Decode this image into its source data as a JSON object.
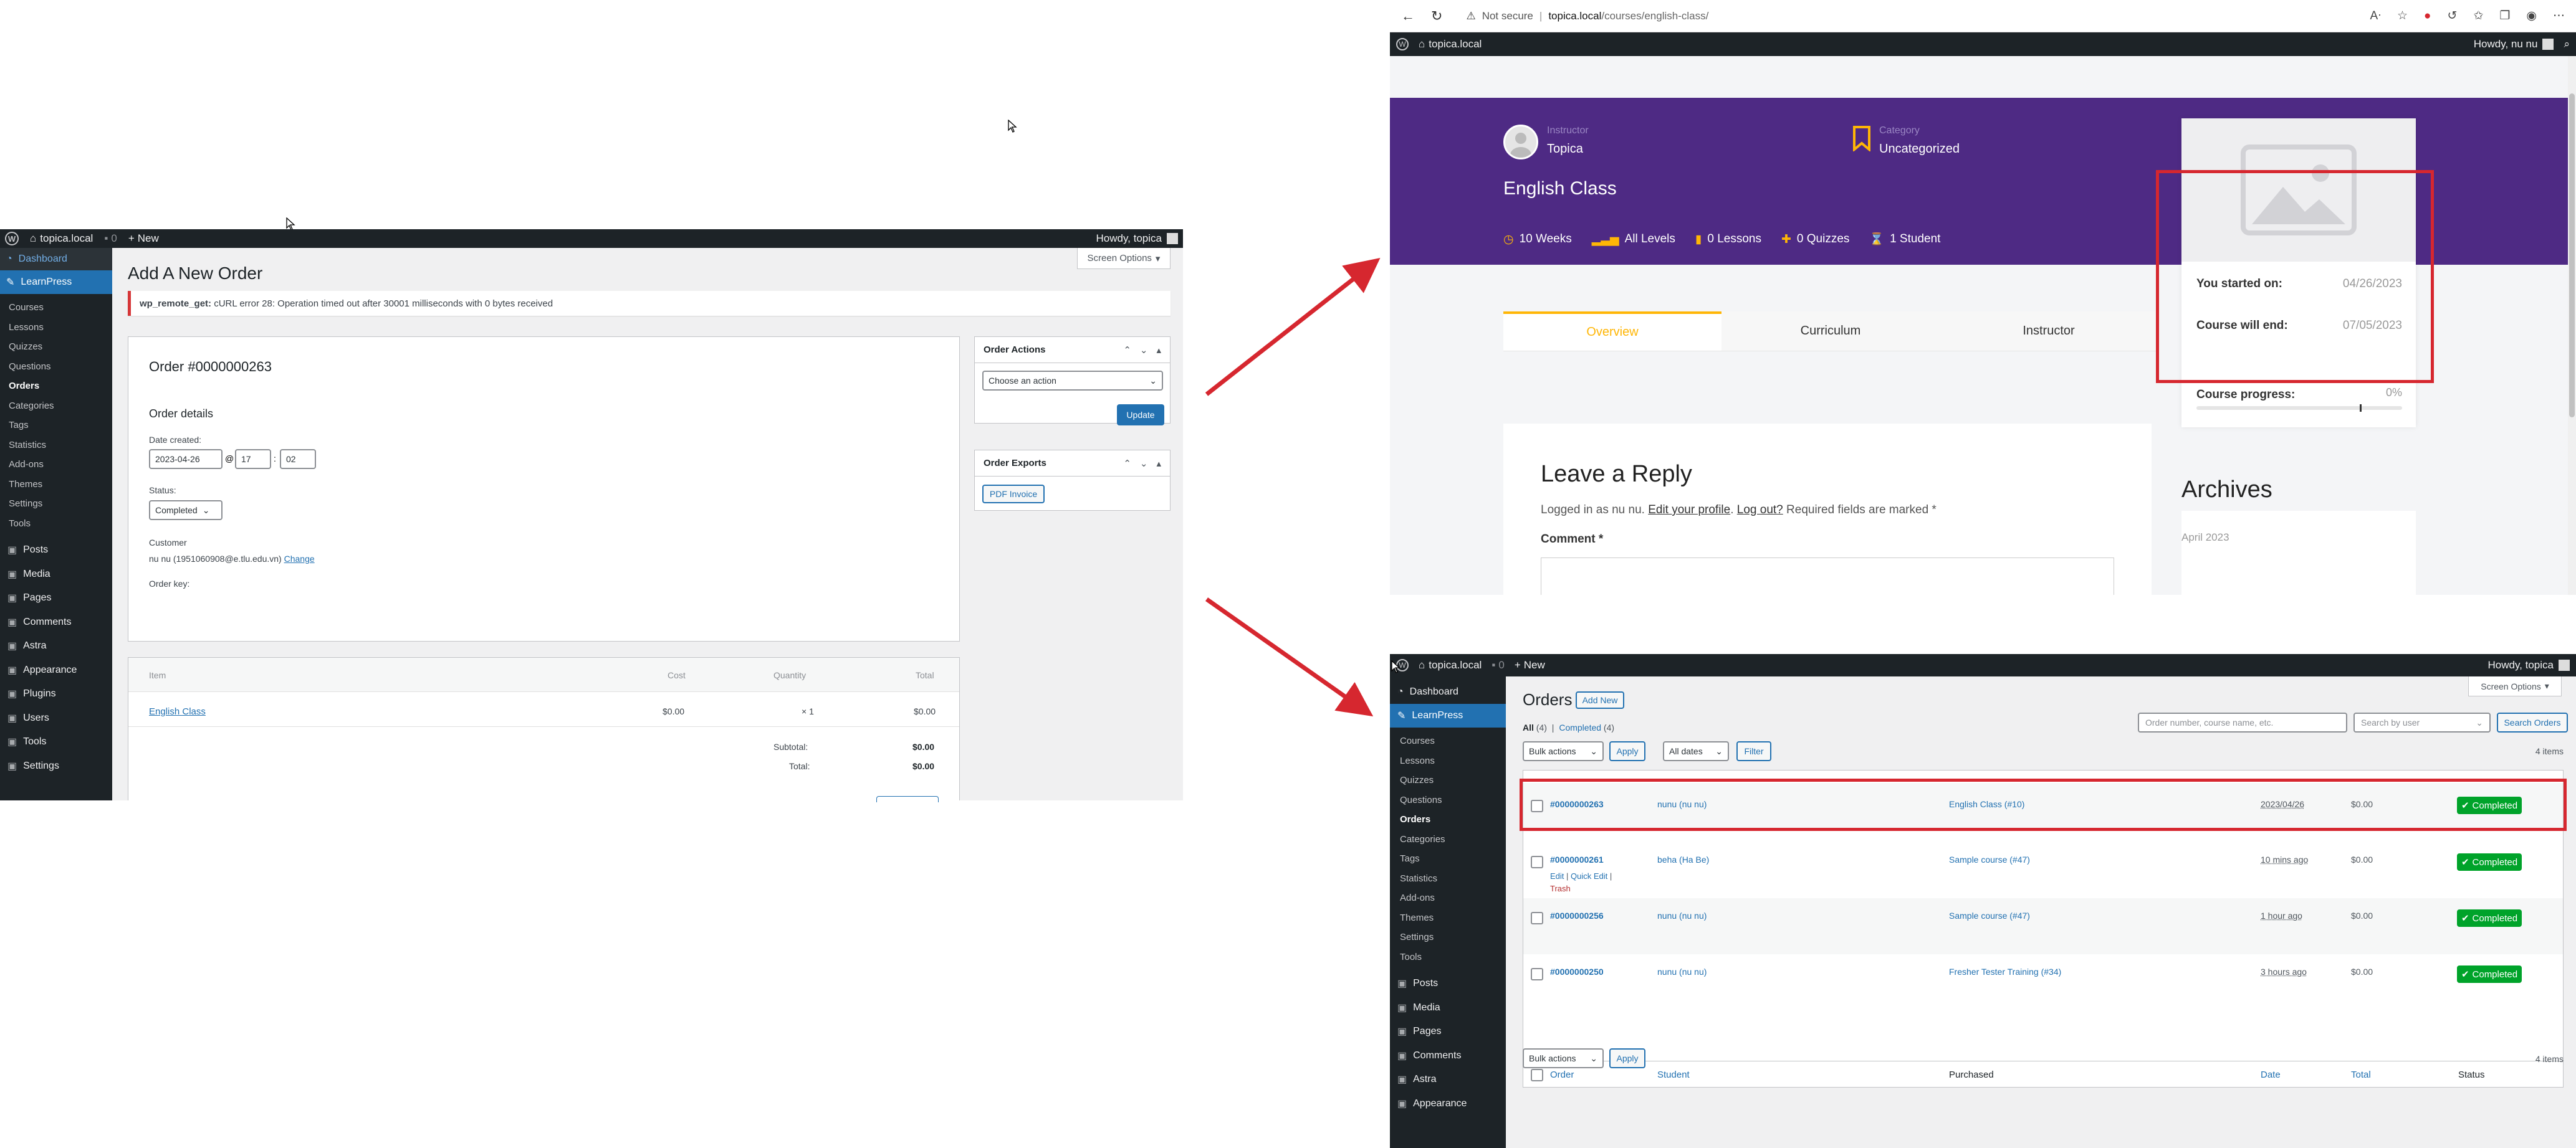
{
  "left": {
    "adminbar": {
      "site": "topica.local",
      "comments": "0",
      "new": "New",
      "howdy": "Howdy, topica"
    },
    "sidebar": {
      "dashboard": "Dashboard",
      "learnpress": "LearnPress",
      "sub": [
        "Courses",
        "Lessons",
        "Quizzes",
        "Questions",
        "Orders",
        "Categories",
        "Tags",
        "Statistics",
        "Add-ons",
        "Themes",
        "Settings",
        "Tools"
      ],
      "main": [
        "Posts",
        "Media",
        "Pages",
        "Comments",
        "Astra",
        "Appearance",
        "Plugins",
        "Users",
        "Tools",
        "Settings"
      ]
    },
    "screen_options": "Screen Options",
    "page_title": "Add A New Order",
    "notice": {
      "label": "wp_remote_get:",
      "text": " cURL error 28: Operation timed out after 30001 milliseconds with 0 bytes received"
    },
    "order": {
      "title": "Order #0000000263",
      "details": "Order details",
      "date_label": "Date created:",
      "date": "2023-04-26",
      "at": "@",
      "hour": "17",
      "sep": ":",
      "minute": "02",
      "status_label": "Status:",
      "status": "Completed",
      "customer_label": "Customer",
      "customer": "nu nu (1951060908@e.tlu.edu.vn)",
      "change": "Change",
      "key_label": "Order key:"
    },
    "items": {
      "headers": [
        "Item",
        "Cost",
        "Quantity",
        "Total"
      ],
      "row": {
        "name": "English Class",
        "cost": "$0.00",
        "qty": "× 1",
        "total": "$0.00"
      },
      "subtotal_label": "Subtotal:",
      "subtotal": "$0.00",
      "total_label": "Total:",
      "total": "$0.00"
    },
    "actions": {
      "title": "Order Actions",
      "select": "Choose an action",
      "update": "Update"
    },
    "exports": {
      "title": "Order Exports",
      "pdf": "PDF Invoice"
    }
  },
  "right_top": {
    "browser": {
      "not_secure": "Not secure",
      "url_host": "topica.local",
      "url_path": "/courses/english-class/"
    },
    "adminbar": {
      "site": "topica.local",
      "howdy": "Howdy, nu nu"
    },
    "instructor_label": "Instructor",
    "instructor": "Topica",
    "category_label": "Category",
    "category": "Uncategorized",
    "course_title": "English Class",
    "meta": [
      "10 Weeks",
      "All Levels",
      "0 Lessons",
      "0 Quizzes",
      "1 Student"
    ],
    "tabs": [
      "Overview",
      "Curriculum",
      "Instructor"
    ],
    "started_label": "You started on:",
    "started": "04/26/2023",
    "end_label": "Course will end:",
    "end": "07/05/2023",
    "progress_label": "Course progress:",
    "progress_text": "0%",
    "progress_value": 0,
    "reply_title": "Leave a Reply",
    "logged": "Logged in as nu nu.",
    "edit_profile": "Edit your profile",
    "logout": "Log out?",
    "required": "Required fields are marked *",
    "comment_label": "Comment *",
    "archives": "Archives",
    "archive_item": "April 2023"
  },
  "right_bottom": {
    "adminbar": {
      "site": "topica.local",
      "comments": "0",
      "new": "New",
      "howdy": "Howdy, topica"
    },
    "sidebar": {
      "dashboard": "Dashboard",
      "learnpress": "LearnPress",
      "sub": [
        "Courses",
        "Lessons",
        "Quizzes",
        "Questions",
        "Orders",
        "Categories",
        "Tags",
        "Statistics",
        "Add-ons",
        "Themes",
        "Settings",
        "Tools"
      ],
      "main": [
        "Posts",
        "Media",
        "Pages",
        "Comments",
        "Astra",
        "Appearance"
      ]
    },
    "screen_options": "Screen Options",
    "title": "Orders",
    "add_new": "Add New",
    "filters": {
      "all": "All",
      "all_count": "(4)",
      "sep": "|",
      "completed": "Completed",
      "completed_count": "(4)"
    },
    "search_placeholder": "Order number, course name, etc.",
    "search_user": "Search by user",
    "search_btn": "Search Orders",
    "bulk": "Bulk actions",
    "apply": "Apply",
    "dates": "All dates",
    "filter": "Filter",
    "count": "4 items",
    "headers": [
      "Order",
      "Student",
      "Purchased",
      "Date",
      "Total",
      "Status"
    ],
    "rows": [
      {
        "order": "#0000000263",
        "student": "nunu (nu nu)",
        "purchased": "English Class (#10)",
        "date": "2023/04/26",
        "total": "$0.00",
        "status": "Completed"
      },
      {
        "order": "#0000000261",
        "student": "beha (Ha Be)",
        "purchased": "Sample course (#47)",
        "date": "10 mins ago",
        "total": "$0.00",
        "status": "Completed",
        "actions": {
          "edit": "Edit",
          "quick": "Quick Edit",
          "trash": "Trash"
        }
      },
      {
        "order": "#0000000256",
        "student": "nunu (nu nu)",
        "purchased": "Sample course (#47)",
        "date": "1 hour ago",
        "total": "$0.00",
        "status": "Completed"
      },
      {
        "order": "#0000000250",
        "student": "nunu (nu nu)",
        "purchased": "Fresher Tester Training (#34)",
        "date": "3 hours ago",
        "total": "$0.00",
        "status": "Completed"
      }
    ]
  },
  "colors": {
    "annotation": "#d6272f",
    "wp_dark": "#1d2327",
    "wp_blue": "#2271b1",
    "course_purple": "#4e2a84",
    "completed": "#00a32a"
  }
}
